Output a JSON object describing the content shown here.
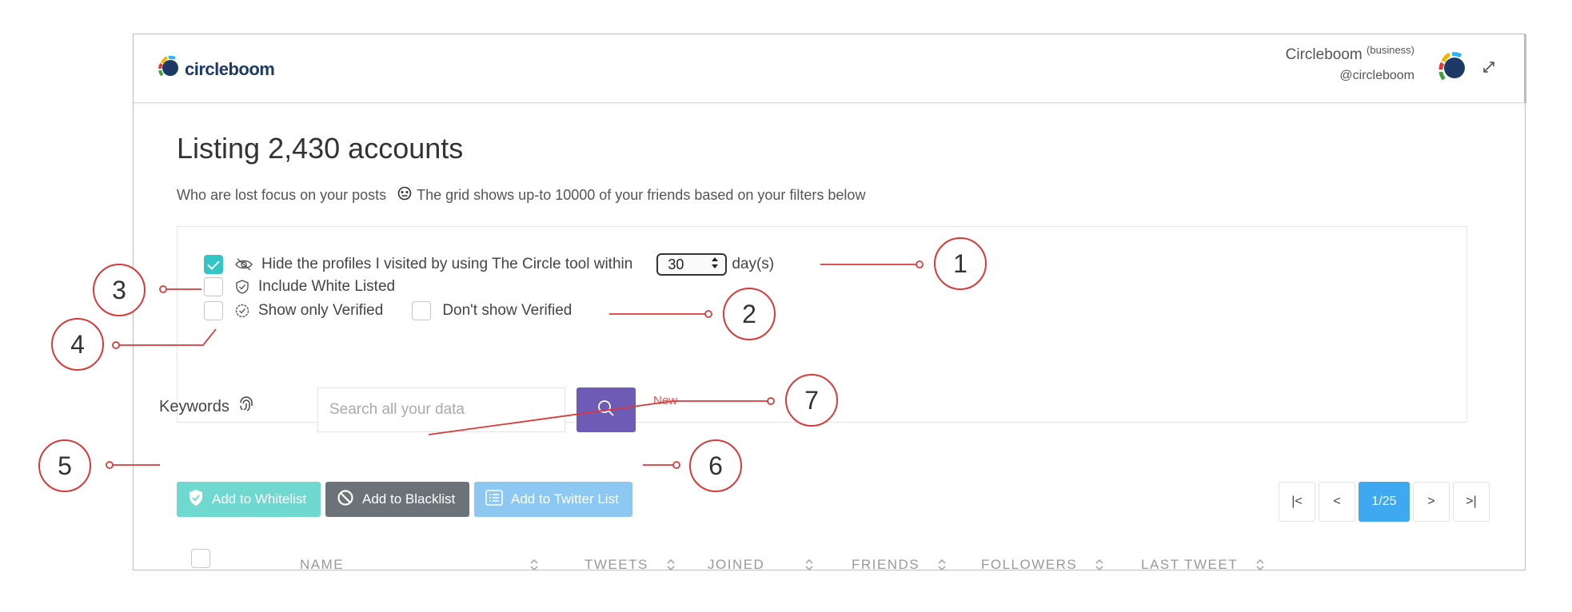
{
  "brand": {
    "name": "circleboom"
  },
  "user": {
    "name": "Circleboom",
    "tier": "(business)",
    "handle": "@circleboom"
  },
  "page": {
    "title_prefix": "Listing",
    "title_count": "2,430 accounts",
    "subtitle_left": "Who are lost focus on your posts",
    "subtitle_right": "The grid shows up-to 10000 of your friends based on your filters below"
  },
  "filters": {
    "hide_visited": {
      "label": "Hide the profiles I visited by using The Circle tool within",
      "checked": true,
      "days": "30",
      "days_unit": "day(s)"
    },
    "include_whitelisted": {
      "label": "Include White Listed",
      "checked": false
    },
    "show_only_verified": {
      "label": "Show only Verified",
      "checked": false
    },
    "dont_show_verified": {
      "label": "Don't show Verified",
      "checked": false
    }
  },
  "search": {
    "label": "Keywords",
    "placeholder": "Search all your data",
    "badge": "New"
  },
  "actions": {
    "whitelist": "Add to Whitelist",
    "blacklist": "Add to Blacklist",
    "twitter_list": "Add to Twitter List"
  },
  "pagination": {
    "first": "|<",
    "prev": "<",
    "current": "1/25",
    "next": ">",
    "last": ">|"
  },
  "table": {
    "columns": [
      "NAME",
      "TWEETS",
      "JOINED",
      "FRIENDS",
      "FOLLOWERS",
      "LAST TWEET"
    ]
  },
  "callouts": [
    "1",
    "2",
    "3",
    "4",
    "5",
    "6",
    "7"
  ],
  "colors": {
    "accent_teal": "#34c5c5",
    "search_button": "#6e5bb5",
    "whitelist_button": "#6fd9cf",
    "blacklist_button": "#6c7378",
    "twitter_button": "#8cc8f2",
    "pager_active": "#3ea9f0",
    "callout_red": "#d83a3a",
    "new_badge": "#f05050"
  },
  "icons": [
    "circleboom-logo-icon",
    "eye-slash-icon",
    "shield-check-icon",
    "verified-badge-icon",
    "fingerprint-icon",
    "search-icon",
    "shield-icon",
    "ban-icon",
    "list-icon",
    "expand-icon",
    "sort-icon",
    "emoji-icon"
  ]
}
